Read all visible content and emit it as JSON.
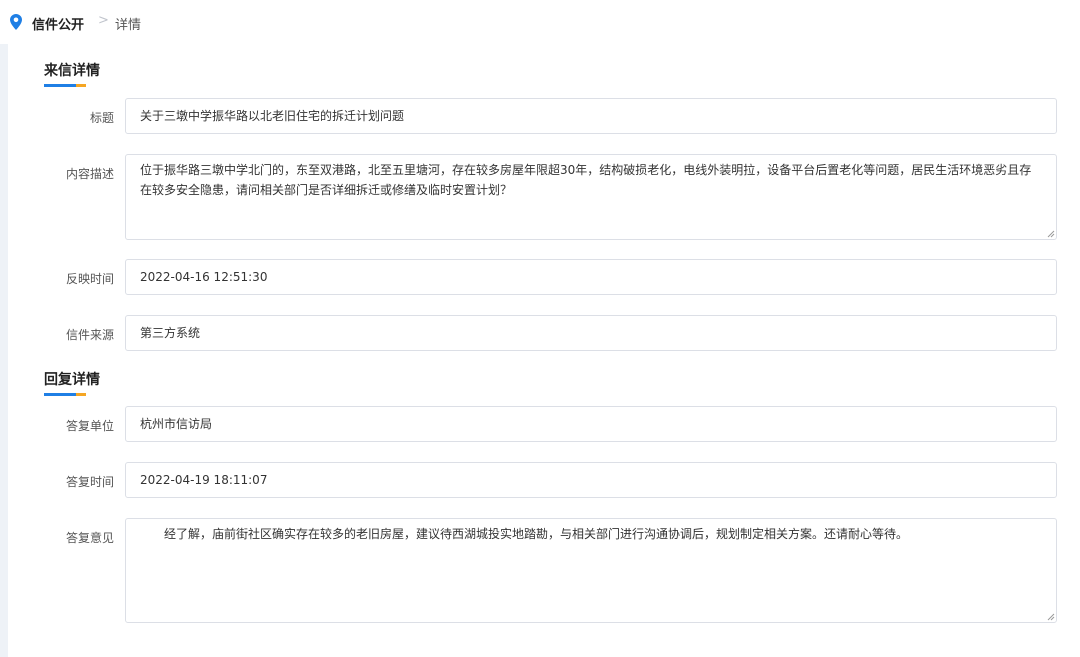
{
  "breadcrumb": {
    "home": "信件公开",
    "separator": ">",
    "current": "详情"
  },
  "letter_section": {
    "title": "来信详情",
    "fields": {
      "title_label": "标题",
      "title_value": "关于三墩中学振华路以北老旧住宅的拆迁计划问题",
      "content_label": "内容描述",
      "content_value": "位于振华路三墩中学北门的，东至双港路，北至五里塘河，存在较多房屋年限超30年，结构破损老化，电线外装明拉，设备平台后置老化等问题，居民生活环境恶劣且存在较多安全隐患，请问相关部门是否详细拆迁或修缮及临时安置计划？",
      "time_label": "反映时间",
      "time_value": "2022-04-16 12:51:30",
      "source_label": "信件来源",
      "source_value": "第三方系统"
    }
  },
  "reply_section": {
    "title": "回复详情",
    "fields": {
      "unit_label": "答复单位",
      "unit_value": "杭州市信访局",
      "time_label": "答复时间",
      "time_value": "2022-04-19 18:11:07",
      "opinion_label": "答复意见",
      "opinion_value": "经了解，庙前街社区确实存在较多的老旧房屋，建议待西湖城投实地踏勘，与相关部门进行沟通协调后，规划制定相关方案。还请耐心等待。"
    }
  },
  "colors": {
    "accent_blue": "#1f7fe5",
    "accent_orange": "#f5a623",
    "page_background": "#eef2f7",
    "border": "#dcdfe6"
  },
  "icons": {
    "breadcrumb": "location-pin-icon"
  }
}
